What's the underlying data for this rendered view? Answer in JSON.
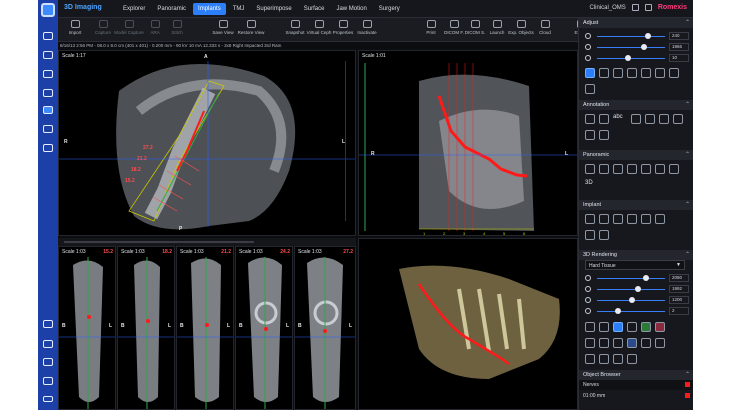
{
  "app": {
    "name": "3D Imaging",
    "user": "Clinical_OMS",
    "brand": "Romexis"
  },
  "tabs": [
    "Explorer",
    "Panoramic",
    "Implants",
    "TMJ",
    "Superimpose",
    "Surface",
    "Jaw Motion",
    "Surgery"
  ],
  "active_tab": "Implants",
  "toolbar": {
    "import": "Import",
    "capture": "Capture",
    "model_capture": "Model Capture",
    "aria": "ARA",
    "stitch": "Stitch",
    "save_view": "Save View",
    "restore_view": "Restore View",
    "snapshot": "Snapshot",
    "virtual_ceph": "Virtual Ceph",
    "properties": "Properties",
    "inactivate": "Inactivate",
    "print": "Print",
    "dicom_f": "DICOM F.",
    "dicom_s": "DICOM S.",
    "launch": "Launch",
    "exp_objects": "Exp. Objects",
    "cloud": "Cloud",
    "export": "Export"
  },
  "info_line": "8/16/13 2:56 PM - 08.0 x 8.0 cm (401 x 401) - 0.200 mm - 90 kV 10 mA 12.333 s - 3x8 Right Impacted 3rd Ram",
  "viewports": {
    "axial": {
      "scale": "Scale 1:17",
      "labels": {
        "top": "A",
        "left": "R",
        "right": "L",
        "bottom": "P"
      },
      "measurements": [
        "27.2",
        "21.2",
        "18.2",
        "15.2"
      ]
    },
    "ortho": {
      "scale": "Scale 1:01",
      "labels": {
        "left": "R",
        "right": "L"
      },
      "ruler": [
        "1",
        "2",
        "3",
        "4",
        "5",
        "6"
      ]
    },
    "slices": [
      {
        "scale": "Scale 1:03",
        "num": "15.2"
      },
      {
        "scale": "Scale 1:03",
        "num": "18.2"
      },
      {
        "scale": "Scale 1:03",
        "num": "21.2"
      },
      {
        "scale": "Scale 1:03",
        "num": "24.2"
      },
      {
        "scale": "Scale 1:03",
        "num": "27.2"
      }
    ],
    "slice_labels": {
      "left": "B",
      "right": "L"
    }
  },
  "right_panel": {
    "adjust": {
      "title": "Adjust",
      "values": [
        "240",
        "1966",
        "10"
      ]
    },
    "annotation": {
      "title": "Annotation",
      "abc": "abc"
    },
    "panoramic": {
      "title": "Panoramic",
      "btn3d": "3D"
    },
    "implant": {
      "title": "Implant"
    },
    "rendering": {
      "title": "3D Rendering",
      "preset": "Hard Tissue",
      "values": [
        "2080",
        "1992",
        "1200",
        "2"
      ]
    },
    "object_browser": {
      "title": "Object Browser",
      "items": [
        {
          "name": "Nerves"
        },
        {
          "name": "01:00 mm"
        }
      ]
    }
  },
  "colors": {
    "accent": "#2d7ff9",
    "brand": "#ff3c7a",
    "nerve": "#ff1a1a",
    "guide": "#00c83c"
  }
}
